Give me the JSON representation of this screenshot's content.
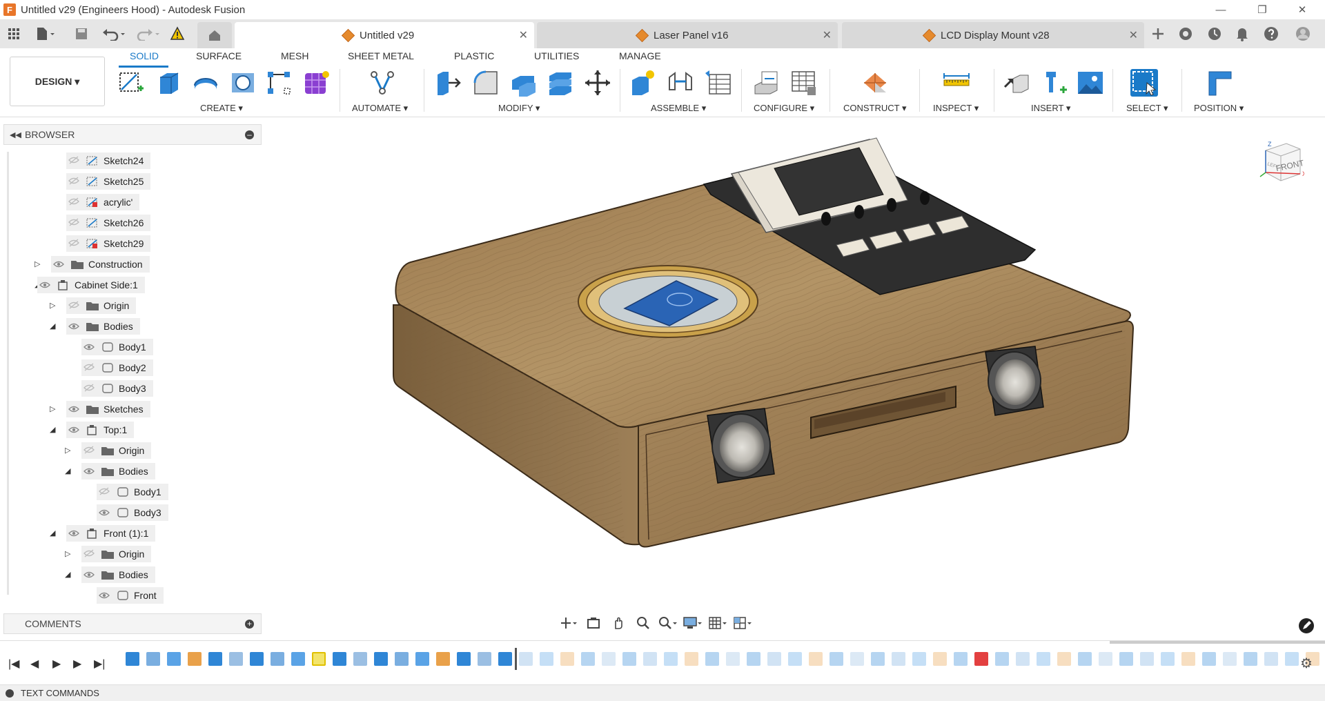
{
  "window": {
    "title": "Untitled v29 (Engineers Hood) - Autodesk Fusion",
    "app_icon_letter": "F",
    "minimize_glyph": "—",
    "restore_glyph": "❐",
    "close_glyph": "✕"
  },
  "tabs": [
    {
      "label": "Untitled v29",
      "active": true
    },
    {
      "label": "Laser Panel v16",
      "active": false
    },
    {
      "label": "LCD Display Mount v28",
      "active": false
    }
  ],
  "tab_close_glyph": "✕",
  "design_button": {
    "label": "DESIGN ▾"
  },
  "ribbon_tabs": [
    {
      "label": "SOLID",
      "active": true
    },
    {
      "label": "SURFACE"
    },
    {
      "label": "MESH"
    },
    {
      "label": "SHEET METAL"
    },
    {
      "label": "PLASTIC"
    },
    {
      "label": "UTILITIES"
    },
    {
      "label": "MANAGE"
    }
  ],
  "ribbon_groups": {
    "create": "CREATE ▾",
    "automate": "AUTOMATE ▾",
    "modify": "MODIFY ▾",
    "assemble": "ASSEMBLE ▾",
    "configure": "CONFIGURE ▾",
    "construct": "CONSTRUCT ▾",
    "inspect": "INSPECT ▾",
    "insert": "INSERT ▾",
    "select": "SELECT ▾",
    "position": "POSITION ▾"
  },
  "browser": {
    "title": "BROWSER",
    "items": [
      {
        "label": "Sketch24",
        "type": "sketch",
        "visible": false
      },
      {
        "label": "Sketch25",
        "type": "sketch",
        "visible": false
      },
      {
        "label": "acrylic'",
        "type": "sketch-error",
        "visible": false
      },
      {
        "label": "Sketch26",
        "type": "sketch",
        "visible": false
      },
      {
        "label": "Sketch29",
        "type": "sketch-error",
        "visible": false
      },
      {
        "label": "Construction",
        "type": "folder",
        "visible": true,
        "expanded": false
      },
      {
        "label": "Cabinet Side:1",
        "type": "component",
        "visible": true,
        "expanded": true
      },
      {
        "label": "Origin",
        "type": "folder",
        "visible": false,
        "expanded": false
      },
      {
        "label": "Bodies",
        "type": "folder",
        "visible": true,
        "expanded": true
      },
      {
        "label": "Body1",
        "type": "body",
        "visible": true
      },
      {
        "label": "Body2",
        "type": "body",
        "visible": false
      },
      {
        "label": "Body3",
        "type": "body",
        "visible": false
      },
      {
        "label": "Sketches",
        "type": "folder",
        "visible": true,
        "expanded": false
      },
      {
        "label": "Top:1",
        "type": "component",
        "visible": true,
        "expanded": true
      },
      {
        "label": "Origin",
        "type": "folder",
        "visible": false,
        "expanded": false
      },
      {
        "label": "Bodies",
        "type": "folder",
        "visible": true,
        "expanded": true
      },
      {
        "label": "Body1",
        "type": "body",
        "visible": false
      },
      {
        "label": "Body3",
        "type": "body",
        "visible": true
      },
      {
        "label": "Front (1):1",
        "type": "component",
        "visible": true,
        "expanded": true
      },
      {
        "label": "Origin",
        "type": "folder",
        "visible": false,
        "expanded": false
      },
      {
        "label": "Bodies",
        "type": "folder",
        "visible": true,
        "expanded": true
      },
      {
        "label": "Front",
        "type": "body",
        "visible": true
      }
    ]
  },
  "comments": {
    "title": "COMMENTS"
  },
  "text_commands": {
    "title": "TEXT COMMANDS"
  },
  "viewcube": {
    "face_label": "FRONT",
    "face_side_label": "LEFT",
    "axis_x": "X",
    "axis_z": "Z"
  },
  "nav_icons": [
    "orbit-icon",
    "look-at-icon",
    "pan-icon",
    "zoom-icon",
    "zoom-window-icon",
    "display-settings-icon",
    "grid-icon",
    "viewports-icon"
  ],
  "timeline": {
    "controls": [
      "|◀",
      "◀",
      "▶",
      "▶",
      "▶|"
    ],
    "feature_count": 59
  },
  "colors": {
    "accent": "#1a7ac8",
    "wood": "#a9885e",
    "panel": "#2b2b2b",
    "pcb": "#2a64b5"
  }
}
